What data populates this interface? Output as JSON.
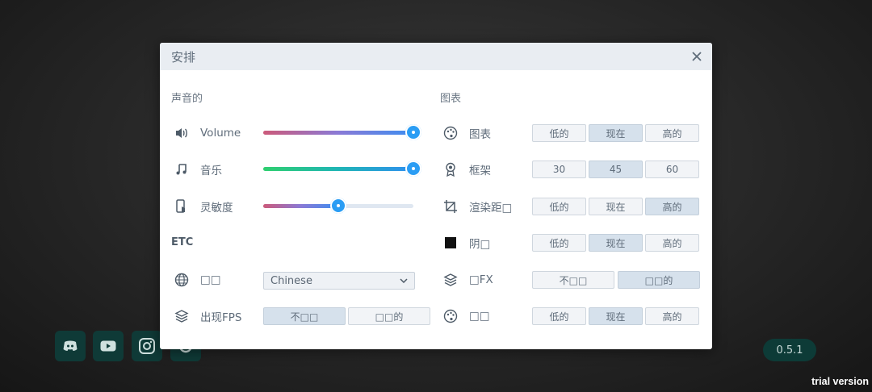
{
  "dialog": {
    "title": "安排"
  },
  "sound": {
    "header": "声音的",
    "rows": [
      {
        "label": "Volume",
        "value": 1.0,
        "gradient": [
          "#cc5a7a",
          "#8a7ad6",
          "#3d8df0"
        ]
      },
      {
        "label": "音乐",
        "value": 1.0,
        "gradient": [
          "#2fcf6f",
          "#1fb5b5",
          "#2f8ff0"
        ]
      },
      {
        "label": "灵敏度",
        "value": 0.5,
        "gradient": [
          "#cc5a7a",
          "#8a7ad6",
          "#3d8df0"
        ]
      }
    ]
  },
  "etc": {
    "header": "ETC",
    "language": {
      "label": "□□",
      "value": "Chinese"
    },
    "fps": {
      "label": "出现FPS",
      "options": [
        "不□□",
        "□□的"
      ],
      "selected": 0
    }
  },
  "graphics": {
    "header": "图表",
    "rows": [
      {
        "label": "图表",
        "icon": "palette-icon",
        "options": [
          "低的",
          "现在",
          "高的"
        ],
        "selected": 1
      },
      {
        "label": "框架",
        "icon": "award-icon",
        "options": [
          "30",
          "45",
          "60"
        ],
        "selected": 1
      },
      {
        "label": "渲染距□",
        "icon": "crop-icon",
        "options": [
          "低的",
          "现在",
          "高的"
        ],
        "selected": 2
      },
      {
        "label": "阴□",
        "icon": "square-icon",
        "options": [
          "低的",
          "现在",
          "高的"
        ],
        "selected": 1
      },
      {
        "label": "□FX",
        "icon": "layers-icon",
        "options": [
          "不□□",
          "□□的"
        ],
        "selected": 1
      },
      {
        "label": "□□",
        "icon": "palette-icon",
        "options": [
          "低的",
          "现在",
          "高的"
        ],
        "selected": 1
      }
    ]
  },
  "footer": {
    "version": "0.5.1",
    "trial": "trial version",
    "social": [
      "discord-icon",
      "youtube-icon",
      "instagram-icon",
      "extra-icon"
    ]
  }
}
